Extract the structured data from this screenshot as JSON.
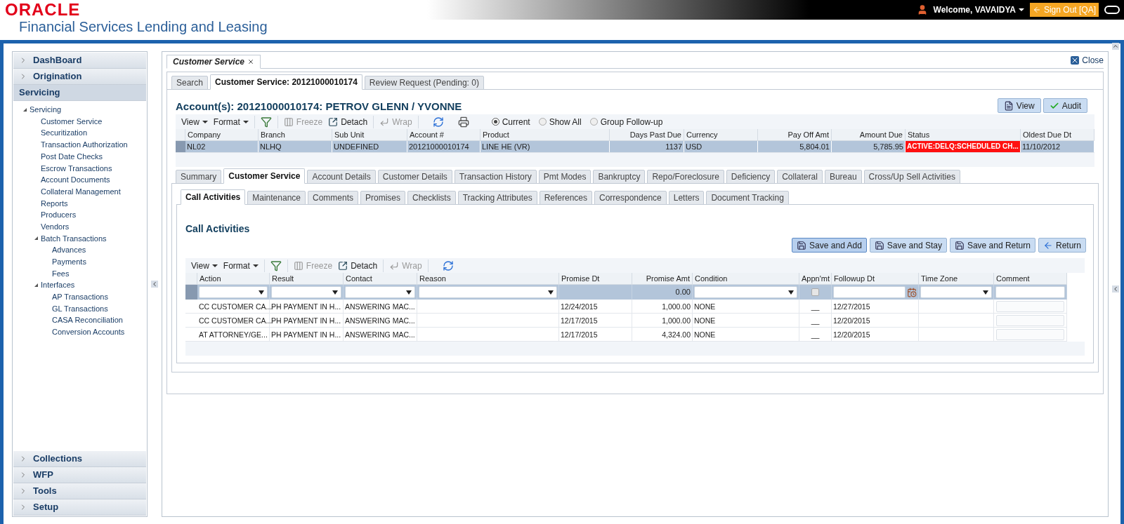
{
  "header": {
    "logo": "ORACLE",
    "product": "Financial Services Lending and Leasing",
    "welcome": "Welcome, VAVAIDYA",
    "sign_out": "Sign Out [QA]"
  },
  "sidebar": {
    "sections": [
      {
        "label": "DashBoard",
        "expanded": false
      },
      {
        "label": "Origination",
        "expanded": false
      },
      {
        "label": "Servicing",
        "expanded": true,
        "tree": [
          {
            "label": "Servicing",
            "expanded": true,
            "children": [
              {
                "label": "Customer Service"
              },
              {
                "label": "Securitization"
              },
              {
                "label": "Transaction Authorization"
              },
              {
                "label": "Post Date Checks"
              },
              {
                "label": "Escrow Transactions"
              },
              {
                "label": "Account Documents"
              },
              {
                "label": "Collateral Management"
              },
              {
                "label": "Reports"
              },
              {
                "label": "Producers"
              },
              {
                "label": "Vendors"
              },
              {
                "label": "Batch Transactions",
                "expanded": true,
                "children": [
                  {
                    "label": "Advances"
                  },
                  {
                    "label": "Payments"
                  },
                  {
                    "label": "Fees"
                  }
                ]
              },
              {
                "label": "Interfaces",
                "expanded": true,
                "children": [
                  {
                    "label": "AP Transactions"
                  },
                  {
                    "label": "GL Transactions"
                  },
                  {
                    "label": "CASA Reconciliation"
                  },
                  {
                    "label": "Conversion Accounts"
                  }
                ]
              }
            ]
          }
        ]
      },
      {
        "label": "Collections",
        "expanded": false
      },
      {
        "label": "WFP",
        "expanded": false
      },
      {
        "label": "Tools",
        "expanded": false
      },
      {
        "label": "Setup",
        "expanded": false
      }
    ]
  },
  "document_tab": "Customer Service",
  "close": "Close",
  "tabs": [
    {
      "label": "Search",
      "selected": false
    },
    {
      "label": "Customer Service: 20121000010174",
      "selected": true
    },
    {
      "label": "Review Request (Pending: 0)",
      "selected": false
    }
  ],
  "account_title": "Account(s): 20121000010174: PETROV GLENN / YVONNE",
  "account_buttons": [
    "View",
    "Audit"
  ],
  "account_toolbar": {
    "view": "View",
    "format": "Format",
    "freeze": {
      "label": "Freeze",
      "disabled": true
    },
    "detach": {
      "label": "Detach",
      "disabled": false
    },
    "wrap": {
      "label": "Wrap",
      "disabled": true
    }
  },
  "radios": [
    {
      "label": "Current",
      "selected": true
    },
    {
      "label": "Show All",
      "selected": false
    },
    {
      "label": "Group Follow-up",
      "selected": false
    }
  ],
  "account_table": {
    "columns": [
      {
        "label": "Company",
        "kind": "text"
      },
      {
        "label": "Branch",
        "kind": "text"
      },
      {
        "label": "Sub Unit",
        "kind": "text"
      },
      {
        "label": "Account #",
        "kind": "text"
      },
      {
        "label": "Product",
        "kind": "text"
      },
      {
        "label": "Days Past Due",
        "kind": "number"
      },
      {
        "label": "Currency",
        "kind": "text"
      },
      {
        "label": "Pay Off Amt",
        "kind": "number"
      },
      {
        "label": "Amount Due",
        "kind": "number"
      },
      {
        "label": "Status",
        "kind": "text"
      },
      {
        "label": "Oldest Due Dt",
        "kind": "text"
      }
    ],
    "rows": [
      {
        "selected": true,
        "cells": [
          {
            "text": "NL02",
            "alert": false
          },
          {
            "text": "NLHQ",
            "alert": false
          },
          {
            "text": "UNDEFINED",
            "alert": false
          },
          {
            "text": "20121000010174",
            "alert": false
          },
          {
            "text": "LINE HE (VR)",
            "alert": false
          },
          {
            "text": "1137",
            "alert": false
          },
          {
            "text": "USD",
            "alert": false
          },
          {
            "text": "5,804.01",
            "alert": false
          },
          {
            "text": "5,785.95",
            "alert": false
          },
          {
            "text": "ACTIVE:DELQ:SCHEDULED CH...",
            "alert": true
          },
          {
            "text": "11/10/2012",
            "alert": false
          }
        ]
      }
    ]
  },
  "account_tabs": [
    {
      "label": "Summary",
      "selected": false
    },
    {
      "label": "Customer Service",
      "selected": true
    },
    {
      "label": "Account Details",
      "selected": false
    },
    {
      "label": "Customer Details",
      "selected": false
    },
    {
      "label": "Transaction History",
      "selected": false
    },
    {
      "label": "Pmt Modes",
      "selected": false
    },
    {
      "label": "Bankruptcy",
      "selected": false
    },
    {
      "label": "Repo/Foreclosure",
      "selected": false
    },
    {
      "label": "Deficiency",
      "selected": false
    },
    {
      "label": "Collateral",
      "selected": false
    },
    {
      "label": "Bureau",
      "selected": false
    },
    {
      "label": "Cross/Up Sell Activities",
      "selected": false
    }
  ],
  "sub_tabs": [
    {
      "label": "Call Activities",
      "selected": true
    },
    {
      "label": "Maintenance",
      "selected": false
    },
    {
      "label": "Comments",
      "selected": false
    },
    {
      "label": "Promises",
      "selected": false
    },
    {
      "label": "Checklists",
      "selected": false
    },
    {
      "label": "Tracking Attributes",
      "selected": false
    },
    {
      "label": "References",
      "selected": false
    },
    {
      "label": "Correspondence",
      "selected": false
    },
    {
      "label": "Letters",
      "selected": false
    },
    {
      "label": "Document Tracking",
      "selected": false
    }
  ],
  "section_title": "Call Activities",
  "action_buttons": [
    {
      "label": "Save and Add",
      "kind": "save",
      "focused": true
    },
    {
      "label": "Save and Stay",
      "kind": "save",
      "focused": false
    },
    {
      "label": "Save and Return",
      "kind": "save",
      "focused": false
    },
    {
      "label": "Return",
      "kind": "back",
      "focused": false
    }
  ],
  "call_toolbar": {
    "view": "View",
    "format": "Format",
    "freeze": {
      "label": "Freeze",
      "disabled": true
    },
    "detach": {
      "label": "Detach",
      "disabled": false
    },
    "wrap": {
      "label": "Wrap",
      "disabled": true
    }
  },
  "call_table": {
    "columns": [
      {
        "label": "Action",
        "kind": "text"
      },
      {
        "label": "Result",
        "kind": "text"
      },
      {
        "label": "Contact",
        "kind": "text"
      },
      {
        "label": "Reason",
        "kind": "text"
      },
      {
        "label": "Promise Dt",
        "kind": "text"
      },
      {
        "label": "Promise Amt",
        "kind": "number"
      },
      {
        "label": "Condition",
        "kind": "text"
      },
      {
        "label": "Appn'mt",
        "kind": "text"
      },
      {
        "label": "Followup Dt",
        "kind": "text"
      },
      {
        "label": "Time Zone",
        "kind": "text"
      },
      {
        "label": "Comment",
        "kind": "text"
      }
    ],
    "filter": [
      {
        "kind": "select"
      },
      {
        "kind": "select"
      },
      {
        "kind": "select"
      },
      {
        "kind": "select"
      },
      {
        "kind": "blank"
      },
      {
        "kind": "value",
        "text": "0.00"
      },
      {
        "kind": "select"
      },
      {
        "kind": "checkbox",
        "checked": false
      },
      {
        "kind": "date"
      },
      {
        "kind": "select"
      },
      {
        "kind": "input"
      }
    ],
    "rows": [
      {
        "cells": [
          {
            "kind": "text",
            "text": "CC CUSTOMER CA..."
          },
          {
            "kind": "text",
            "text": "PH PAYMENT IN H..."
          },
          {
            "kind": "text",
            "text": "ANSWERING MAC..."
          },
          {
            "kind": "blank"
          },
          {
            "kind": "text",
            "text": "12/24/2015"
          },
          {
            "kind": "number",
            "text": "1,000.00"
          },
          {
            "kind": "text",
            "text": "NONE"
          },
          {
            "kind": "center",
            "text": "__"
          },
          {
            "kind": "text",
            "text": "12/27/2015"
          },
          {
            "kind": "blank"
          },
          {
            "kind": "input"
          }
        ]
      },
      {
        "cells": [
          {
            "kind": "text",
            "text": "CC CUSTOMER CA..."
          },
          {
            "kind": "text",
            "text": "PH PAYMENT IN H..."
          },
          {
            "kind": "text",
            "text": "ANSWERING MAC..."
          },
          {
            "kind": "blank"
          },
          {
            "kind": "text",
            "text": "12/17/2015"
          },
          {
            "kind": "number",
            "text": "1,000.00"
          },
          {
            "kind": "text",
            "text": "NONE"
          },
          {
            "kind": "center",
            "text": "__"
          },
          {
            "kind": "text",
            "text": "12/20/2015"
          },
          {
            "kind": "blank"
          },
          {
            "kind": "input"
          }
        ]
      },
      {
        "cells": [
          {
            "kind": "text",
            "text": "AT ATTORNEY/GE..."
          },
          {
            "kind": "text",
            "text": "PH PAYMENT IN H..."
          },
          {
            "kind": "text",
            "text": "ANSWERING MAC..."
          },
          {
            "kind": "blank"
          },
          {
            "kind": "text",
            "text": "12/17/2015"
          },
          {
            "kind": "number",
            "text": "4,324.00"
          },
          {
            "kind": "text",
            "text": "NONE"
          },
          {
            "kind": "center",
            "text": "__"
          },
          {
            "kind": "text",
            "text": "12/20/2015"
          },
          {
            "kind": "blank"
          },
          {
            "kind": "input"
          }
        ]
      }
    ]
  }
}
